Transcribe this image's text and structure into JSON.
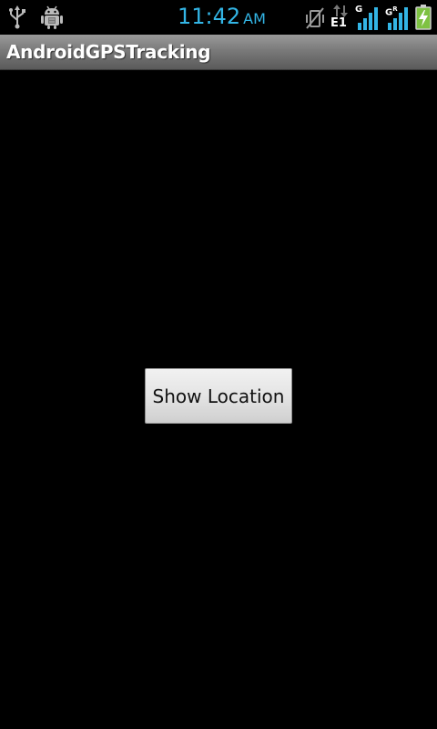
{
  "status_bar": {
    "time": "11:42",
    "ampm": "AM",
    "network_type": "E1",
    "signal_1_label": "G",
    "signal_2_label": "G",
    "signal_2_sup": "R",
    "time_color": "#33b5e5",
    "signal_color": "#33b5e5",
    "battery_color": "#7ec242",
    "icons": {
      "left": [
        "usb-icon",
        "android-debug-icon"
      ],
      "right": [
        "vibrate-off-icon",
        "data-arrows-icon",
        "signal-bars-icon",
        "signal-bars-roaming-icon",
        "battery-charging-icon"
      ]
    }
  },
  "title_bar": {
    "title": "AndroidGPSTracking"
  },
  "main": {
    "show_location_button_label": "Show Location"
  }
}
